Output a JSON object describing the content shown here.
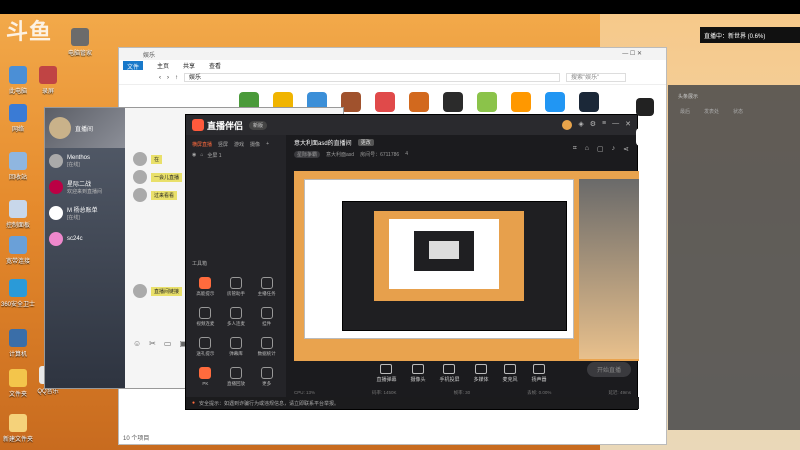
{
  "watermark": "斗鱼",
  "live_status": "直播中：新世界 (0.6%)",
  "desktop_icons": [
    {
      "label": "此电脑"
    },
    {
      "label": "网络"
    },
    {
      "label": "回收站"
    },
    {
      "label": "控制面板"
    },
    {
      "label": "宽带连接"
    },
    {
      "label": "360安全卫士"
    },
    {
      "label": "计算机"
    },
    {
      "label": "电脑管家"
    },
    {
      "label": "新建文件夹"
    },
    {
      "label": "文件夹"
    },
    {
      "label": "录屏"
    },
    {
      "label": "QQ音乐"
    }
  ],
  "explorer": {
    "title": "娱乐",
    "tabs": [
      "文件",
      "主页",
      "共享",
      "查看"
    ],
    "address": "娱乐",
    "search_placeholder": "搜索\"娱乐\"",
    "status": "10 个项目",
    "icon_colors": [
      "#4a9a3a",
      "#f0b400",
      "#3b8fd8",
      "#a0522d",
      "#6b4fbb",
      "#e04a4a",
      "#d2691e",
      "#8bc34a",
      "#ff9800",
      "#2196f3",
      "#444444",
      "#222222"
    ]
  },
  "qq": {
    "header_name": "直播间",
    "contacts": [
      {
        "name": "Menthos",
        "sub": "[在线]"
      },
      {
        "name": "星际二战",
        "sub": "欢迎来到直播间"
      },
      {
        "name": "M 杨总账单",
        "sub": "[在线]"
      },
      {
        "name": "sc24c",
        "sub": ""
      }
    ],
    "messages": [
      "在",
      "一会儿直播",
      "过来看看",
      "直播间链接"
    ],
    "title": "Menthos"
  },
  "stream": {
    "app_name": "直播伴侣",
    "version": "新版",
    "scene_tabs": [
      "横屏直播",
      "竖屏",
      "游戏",
      "摄像"
    ],
    "scene_item": "全屏 1",
    "toolbox_title": "工具箱",
    "tools": [
      "高能提示",
      "房管助手",
      "主播任务",
      "视频连麦",
      "多人连麦",
      "挂件",
      "送礼提示",
      "弹幕库",
      "数据统计",
      "PK",
      "直播回放",
      "更多"
    ],
    "room_title": "意大利面asd的直播间",
    "room_tag": "更改",
    "room_category": "星际争霸",
    "room_id": "房间号：6711786",
    "room_host": "意大利面asd",
    "room_fans": "4",
    "bottom_tools": [
      "直播弹幕",
      "摄像头",
      "手机投屏",
      "多媒体",
      "麦克风",
      "扬声器"
    ],
    "go_live": "开始直播",
    "notice": "安全提示：如遇到诈骗行为或违规信息，请立即联系平台举报。",
    "stats": [
      "CPU: 13%",
      "码率: 1450K",
      "帧率: 30",
      "丢帧: 0.00%",
      "延迟: 49ms"
    ]
  },
  "side_panel": {
    "title": "头条展示",
    "cols": [
      "最后",
      "发表处",
      "状态"
    ]
  }
}
